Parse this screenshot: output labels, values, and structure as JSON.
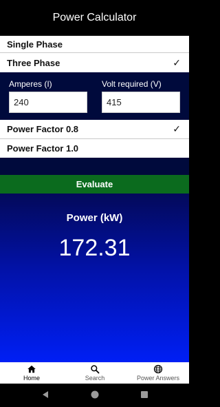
{
  "app_bar": {
    "title": "Power Calculator"
  },
  "phase_options": [
    {
      "label": "Single Phase",
      "selected": false
    },
    {
      "label": "Three Phase",
      "selected": true
    }
  ],
  "inputs": {
    "amperes": {
      "label": "Amperes (I)",
      "value": "240"
    },
    "volts": {
      "label": "Volt required (V)",
      "value": "415"
    }
  },
  "power_factor_options": [
    {
      "label": "Power Factor 0.8",
      "selected": true
    },
    {
      "label": "Power Factor 1.0",
      "selected": false
    }
  ],
  "check_mark": "✓",
  "evaluate_button": {
    "label": "Evaluate"
  },
  "result": {
    "title": "Power (kW)",
    "value": "172.31"
  },
  "bottom_nav": [
    {
      "label": "Home",
      "icon": "home-icon",
      "active": true
    },
    {
      "label": "Search",
      "icon": "search-icon",
      "active": false
    },
    {
      "label": "Power Answers",
      "icon": "globe-icon",
      "active": false
    }
  ],
  "colors": {
    "panel_navy": "#000a3c",
    "evaluate_green": "#0b6b1e",
    "result_gradient_top": "#03095a",
    "result_gradient_bottom": "#001ff5"
  }
}
